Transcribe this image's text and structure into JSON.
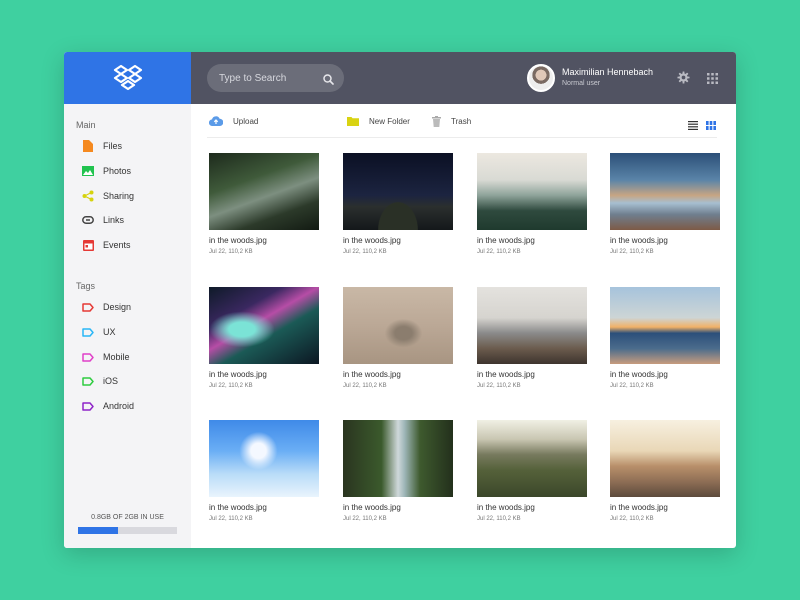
{
  "search": {
    "placeholder": "Type to Search"
  },
  "user": {
    "name": "Maximilian Hennebach",
    "role": "Normal user"
  },
  "sidebar": {
    "main_title": "Main",
    "main_items": [
      {
        "label": "Files",
        "icon": "file-icon",
        "color": "#f5891f"
      },
      {
        "label": "Photos",
        "icon": "photo-icon",
        "color": "#21c34f"
      },
      {
        "label": "Sharing",
        "icon": "share-icon",
        "color": "#d6d30e"
      },
      {
        "label": "Links",
        "icon": "link-icon",
        "color": "#444444"
      },
      {
        "label": "Events",
        "icon": "calendar-icon",
        "color": "#e53935"
      }
    ],
    "tags_title": "Tags",
    "tags": [
      {
        "label": "Design",
        "color": "#e53935"
      },
      {
        "label": "UX",
        "color": "#29b6f6"
      },
      {
        "label": "Mobile",
        "color": "#e040c8"
      },
      {
        "label": "iOS",
        "color": "#2ecc40"
      },
      {
        "label": "Android",
        "color": "#8e24c8"
      }
    ],
    "storage": {
      "text": "0.8GB OF 2GB IN USE",
      "used_fraction": 0.4
    }
  },
  "toolbar": {
    "upload": "Upload",
    "new_folder": "New Folder",
    "trash": "Trash"
  },
  "files": [
    {
      "name": "in the woods.jpg",
      "meta": "Jul 22, 110,2 KB"
    },
    {
      "name": "in the woods.jpg",
      "meta": "Jul 22, 110,2 KB"
    },
    {
      "name": "in the woods.jpg",
      "meta": "Jul 22, 110,2 KB"
    },
    {
      "name": "in the woods.jpg",
      "meta": "Jul 22, 110,2 KB"
    },
    {
      "name": "in the woods.jpg",
      "meta": "Jul 22, 110,2 KB"
    },
    {
      "name": "in the woods.jpg",
      "meta": "Jul 22, 110,2 KB"
    },
    {
      "name": "in the woods.jpg",
      "meta": "Jul 22, 110,2 KB"
    },
    {
      "name": "in the woods.jpg",
      "meta": "Jul 22, 110,2 KB"
    },
    {
      "name": "in the woods.jpg",
      "meta": "Jul 22, 110,2 KB"
    },
    {
      "name": "in the woods.jpg",
      "meta": "Jul 22, 110,2 KB"
    },
    {
      "name": "in the woods.jpg",
      "meta": "Jul 22, 110,2 KB"
    },
    {
      "name": "in the woods.jpg",
      "meta": "Jul 22, 110,2 KB"
    }
  ],
  "colors": {
    "background": "#3fd0a0",
    "brand": "#2f74e6",
    "header": "#515362"
  }
}
